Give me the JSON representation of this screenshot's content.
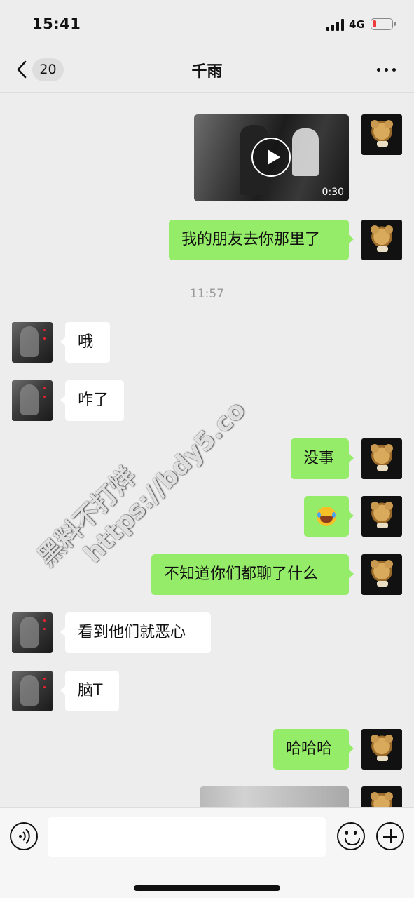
{
  "status_bar": {
    "time": "15:41",
    "network": "4G",
    "battery_level_fraction": 0.12
  },
  "nav": {
    "unread_count": "20",
    "title": "千雨"
  },
  "messages": [
    {
      "sender": "me",
      "type": "video",
      "duration": "0:30"
    },
    {
      "sender": "me",
      "type": "text",
      "text": "我的朋友去你那里了"
    },
    {
      "type": "time",
      "text": "11:57"
    },
    {
      "sender": "them",
      "type": "text",
      "text": "哦"
    },
    {
      "sender": "them",
      "type": "text",
      "text": "咋了"
    },
    {
      "sender": "me",
      "type": "text",
      "text": "没事"
    },
    {
      "sender": "me",
      "type": "emoji",
      "emoji": "laughing-crying-face"
    },
    {
      "sender": "me",
      "type": "text",
      "text": "不知道你们都聊了什么"
    },
    {
      "sender": "them",
      "type": "text",
      "text": "看到他们就恶心"
    },
    {
      "sender": "them",
      "type": "text",
      "text": "脑T"
    },
    {
      "sender": "me",
      "type": "text",
      "text": "哈哈哈"
    },
    {
      "sender": "me",
      "type": "image"
    }
  ],
  "watermark": {
    "line1": "黑料不打烊",
    "line2": "https://bdy5.co"
  },
  "input_bar": {
    "placeholder": "",
    "icons": [
      "voice-icon",
      "emoji-icon",
      "plus-icon"
    ]
  },
  "colors": {
    "my_bubble": "#95ec69",
    "their_bubble": "#ffffff",
    "background": "#ededed",
    "battery_low": "#ef3b3b"
  }
}
